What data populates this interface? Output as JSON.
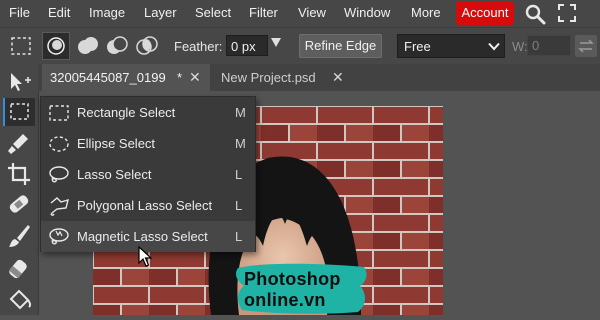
{
  "menubar": {
    "items": [
      "File",
      "Edit",
      "Image",
      "Layer",
      "Select",
      "Filter",
      "View",
      "Window",
      "More"
    ],
    "account_label": "Account",
    "account_color": "#d70b0b"
  },
  "options": {
    "feather_label": "Feather:",
    "feather_value": "0 px",
    "refine_edge_label": "Refine Edge",
    "mode_value": "Free",
    "width_label": "W:",
    "width_value": "0"
  },
  "tabs": [
    {
      "label": "32005445087_0199",
      "marker": "*"
    },
    {
      "label": "New Project.psd"
    }
  ],
  "select_menu": {
    "items": [
      {
        "label": "Rectangle Select",
        "shortcut": "M",
        "icon": "rectangle-select-icon"
      },
      {
        "label": "Ellipse Select",
        "shortcut": "M",
        "icon": "ellipse-select-icon"
      },
      {
        "label": "Lasso Select",
        "shortcut": "L",
        "icon": "lasso-icon"
      },
      {
        "label": "Polygonal Lasso Select",
        "shortcut": "L",
        "icon": "polygonal-lasso-icon"
      },
      {
        "label": "Magnetic Lasso Select",
        "shortcut": "L",
        "icon": "magnetic-lasso-icon"
      }
    ],
    "hovered_index": 4
  },
  "watermark": {
    "line1": "Photoshop",
    "line2": "online.vn"
  },
  "colors": {
    "accent": "#3d8bd8",
    "panel": "#474747",
    "workspace": "#535353"
  }
}
